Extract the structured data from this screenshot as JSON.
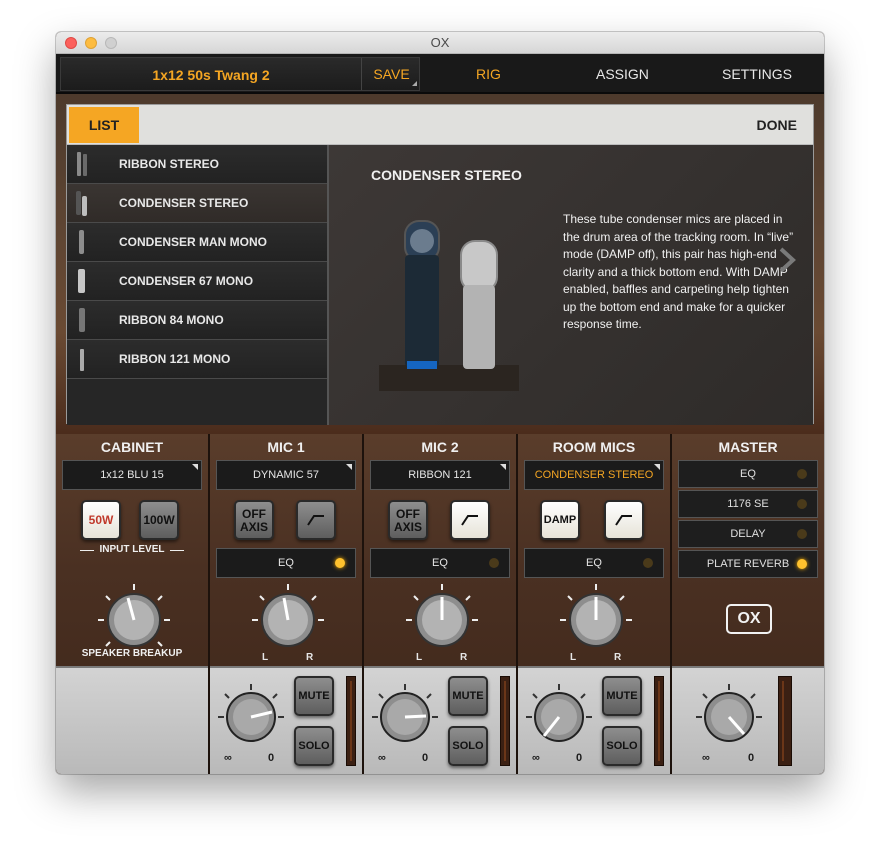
{
  "window": {
    "title": "OX"
  },
  "topbar": {
    "preset_name": "1x12 50s Twang 2",
    "save_label": "SAVE",
    "tabs": [
      "RIG",
      "ASSIGN",
      "SETTINGS"
    ]
  },
  "panel": {
    "list_tab": "LIST",
    "done_label": "DONE",
    "items": [
      "RIBBON STEREO",
      "CONDENSER STEREO",
      "CONDENSER MAN MONO",
      "CONDENSER 67 MONO",
      "RIBBON 84 MONO",
      "RIBBON 121 MONO"
    ],
    "selected_index": 1,
    "detail_title": "CONDENSER STEREO",
    "detail_desc": "These tube condenser mics are placed in the drum area of the tracking room. In “live” mode (DAMP off), this pair has high-end clarity and a thick bottom end. With DAMP enabled, baffles and carpeting help tighten up the bottom end and make for a quicker response time."
  },
  "cabinet": {
    "title": "CABINET",
    "selector": "1x12 BLU 15",
    "btn_50": "50W",
    "btn_100": "100W",
    "input_level": "INPUT LEVEL",
    "knob_label_a": "SPEAKER",
    "knob_label_b": "BREAKUP"
  },
  "mic1": {
    "title": "MIC 1",
    "selector": "DYNAMIC 57",
    "btn1": "OFF AXIS",
    "eq": "EQ",
    "eq_on": true
  },
  "mic2": {
    "title": "MIC 2",
    "selector": "RIBBON 121",
    "btn1": "OFF AXIS",
    "eq": "EQ",
    "eq_on": false
  },
  "room": {
    "title": "ROOM MICS",
    "selector": "CONDENSER STEREO",
    "btn1": "DAMP",
    "eq": "EQ",
    "eq_on": false
  },
  "master": {
    "title": "MASTER",
    "rows": [
      "EQ",
      "1176 SE",
      "DELAY",
      "PLATE REVERB"
    ],
    "rows_on": [
      false,
      false,
      false,
      true
    ],
    "logo": "OX"
  },
  "lower": {
    "mute": "MUTE",
    "solo": "SOLO",
    "l": "L",
    "r": "R",
    "inf": "∞",
    "zero": "0"
  },
  "colors": {
    "accent": "#f5a623",
    "led_on": "#ffc22e"
  }
}
